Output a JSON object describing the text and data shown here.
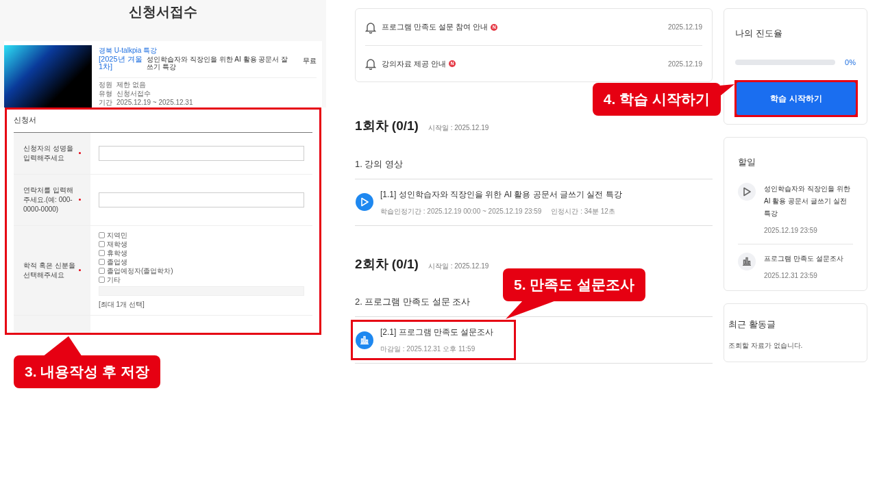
{
  "application_page": {
    "title": "신청서접수",
    "course": {
      "category": "경북 U-talkpia 특강",
      "title_prefix": "[2025년 겨울 1차]",
      "title": "성인학습자와 직장인을 위한 AI 활용 공문서 잘쓰기 특강",
      "price": "무료",
      "meta": [
        {
          "label": "정원",
          "value": "제한 없음"
        },
        {
          "label": "유형",
          "value": "신청서접수"
        },
        {
          "label": "기간",
          "value": "2025.12.19 ~ 2025.12.31"
        }
      ]
    },
    "form": {
      "title": "신청서",
      "highlighted": true,
      "fields": [
        {
          "kind": "text",
          "label": "신청자의 성명을 입력해주세요",
          "required": true
        },
        {
          "kind": "text",
          "label": "연락처를 입력해주세요.(예: 000-0000-0000)",
          "required": true
        },
        {
          "kind": "checkboxes",
          "label": "학적 혹은 신분을 선택해주세요",
          "required": true,
          "note": "[최대 1개 선택]",
          "options": [
            {
              "label": "지역민",
              "checked": false
            },
            {
              "label": "재학생",
              "checked": false
            },
            {
              "label": "휴학생",
              "checked": false
            },
            {
              "label": "졸업생",
              "checked": false
            },
            {
              "label": "졸업예정자(졸업학차)",
              "checked": false
            },
            {
              "label": "기타",
              "checked": false
            }
          ]
        }
      ],
      "callout": "3. 내용작성 후 저장"
    }
  },
  "notices": [
    {
      "title": "프로그램 만족도 설문 참여 안내",
      "badge": "N",
      "date": "2025.12.19"
    },
    {
      "title": "강의자료 제공 안내",
      "badge": "N",
      "date": "2025.12.19"
    }
  ],
  "sessions": [
    {
      "title": "1회차 (0/1)",
      "start": "시작일 : 2025.12.19",
      "section": "1. 강의 영상",
      "items": [
        {
          "kind": "video",
          "title": "[1.1] 성인학습자와 직장인을 위한 AI 활용 공문서 글쓰기 실전 특강",
          "details": [
            "학습인정기간 : 2025.12.19 00:00 ~ 2025.12.19 23:59",
            "인정시간 : 34분 12초"
          ],
          "highlighted": false
        }
      ]
    },
    {
      "title": "2회차 (0/1)",
      "start": "시작일 : 2025.12.19",
      "section": "2. 프로그램 만족도 설문 조사",
      "callout": "5. 만족도 설문조사",
      "items": [
        {
          "kind": "survey",
          "title": "[2.1] 프로그램 만족도 설문조사",
          "details": [
            "마감일 : 2025.12.31 오후 11:59"
          ],
          "highlighted": true
        }
      ]
    }
  ],
  "progress": {
    "title": "나의 진도율",
    "level": 0,
    "reading": "0%",
    "button": "학습 시작하기",
    "highlighted": true,
    "callout": "4. 학습 시작하기"
  },
  "todo": {
    "title": "할일",
    "items": [
      {
        "kind": "video",
        "title": "성인학습자와 직장인을 위한 AI 활용 공문서 글쓰기 실전 특강",
        "date": "2025.12.19 23:59"
      },
      {
        "kind": "survey",
        "title": "프로그램 만족도 설문조사",
        "date": "2025.12.31 23:59"
      }
    ]
  },
  "recent_posts": {
    "title": "최근 활동글",
    "empty": "조회할 자료가 없습니다."
  }
}
